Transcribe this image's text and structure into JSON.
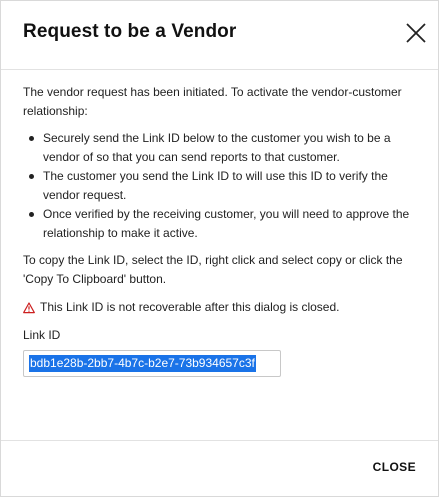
{
  "dialog": {
    "title": "Request to be a Vendor",
    "close_icon": "close-icon",
    "intro": "The vendor request has been initiated. To activate the vendor-customer relationship:",
    "steps": [
      "Securely send the Link ID below to the customer you wish to be a vendor of so that you can send reports to that customer.",
      "The customer you send the Link ID to will use this ID to verify the vendor request.",
      "Once verified by the receiving customer, you will need to approve the relationship to make it active."
    ],
    "copy_instructions": "To copy the Link ID, select the ID, right click and select copy or click the 'Copy To Clipboard' button.",
    "warning_icon": "warning-triangle-icon",
    "warning_text": "This Link ID is not recoverable after this dialog is closed.",
    "link_id_label": "Link ID",
    "link_id_value": "bdb1e28b-2bb7-4b7c-b2e7-73b934657c3f",
    "close_button": "CLOSE"
  },
  "colors": {
    "warning": "#cc1f1f",
    "selection": "#1a73e8",
    "text": "#222222"
  }
}
